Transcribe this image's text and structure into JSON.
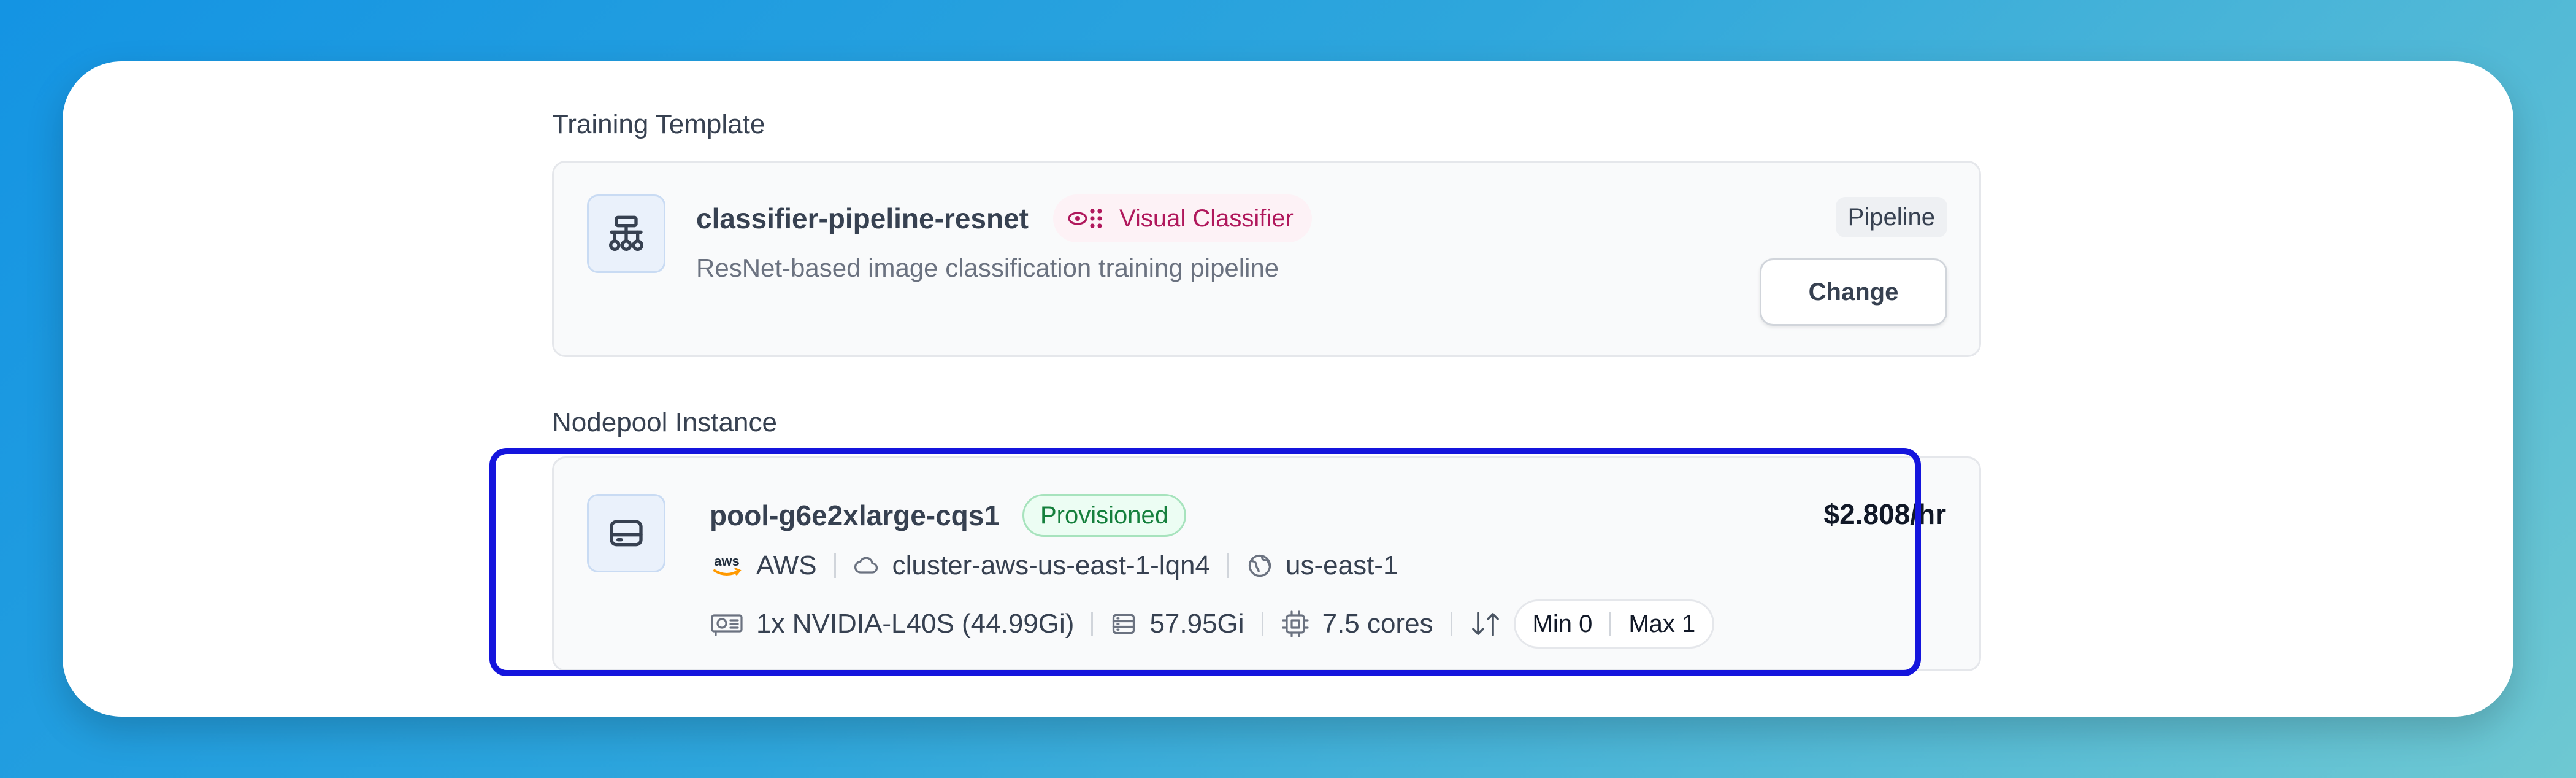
{
  "training_template": {
    "section_label": "Training Template",
    "name": "classifier-pipeline-resnet",
    "tag_label": "Visual Classifier",
    "tag_icon": "visual-classifier-icon",
    "description": "ResNet-based image classification training pipeline",
    "type_badge": "Pipeline",
    "change_button": "Change"
  },
  "nodepool": {
    "section_label": "Nodepool Instance",
    "name": "pool-g6e2xlarge-cqs1",
    "status": "Provisioned",
    "price": "$2.808/hr",
    "provider": "AWS",
    "cluster": "cluster-aws-us-east-1-lqn4",
    "region": "us-east-1",
    "gpu": "1x NVIDIA-L40S (44.99Gi)",
    "memory": "57.95Gi",
    "cpu": "7.5 cores",
    "min": "Min 0",
    "max": "Max 1"
  },
  "colors": {
    "background_start": "#1494e3",
    "background_end": "#6ec8d2",
    "provisioned_green": "#15803d",
    "visual_classifier_pink": "#b0185c",
    "focus_ring": "#1515dd"
  }
}
